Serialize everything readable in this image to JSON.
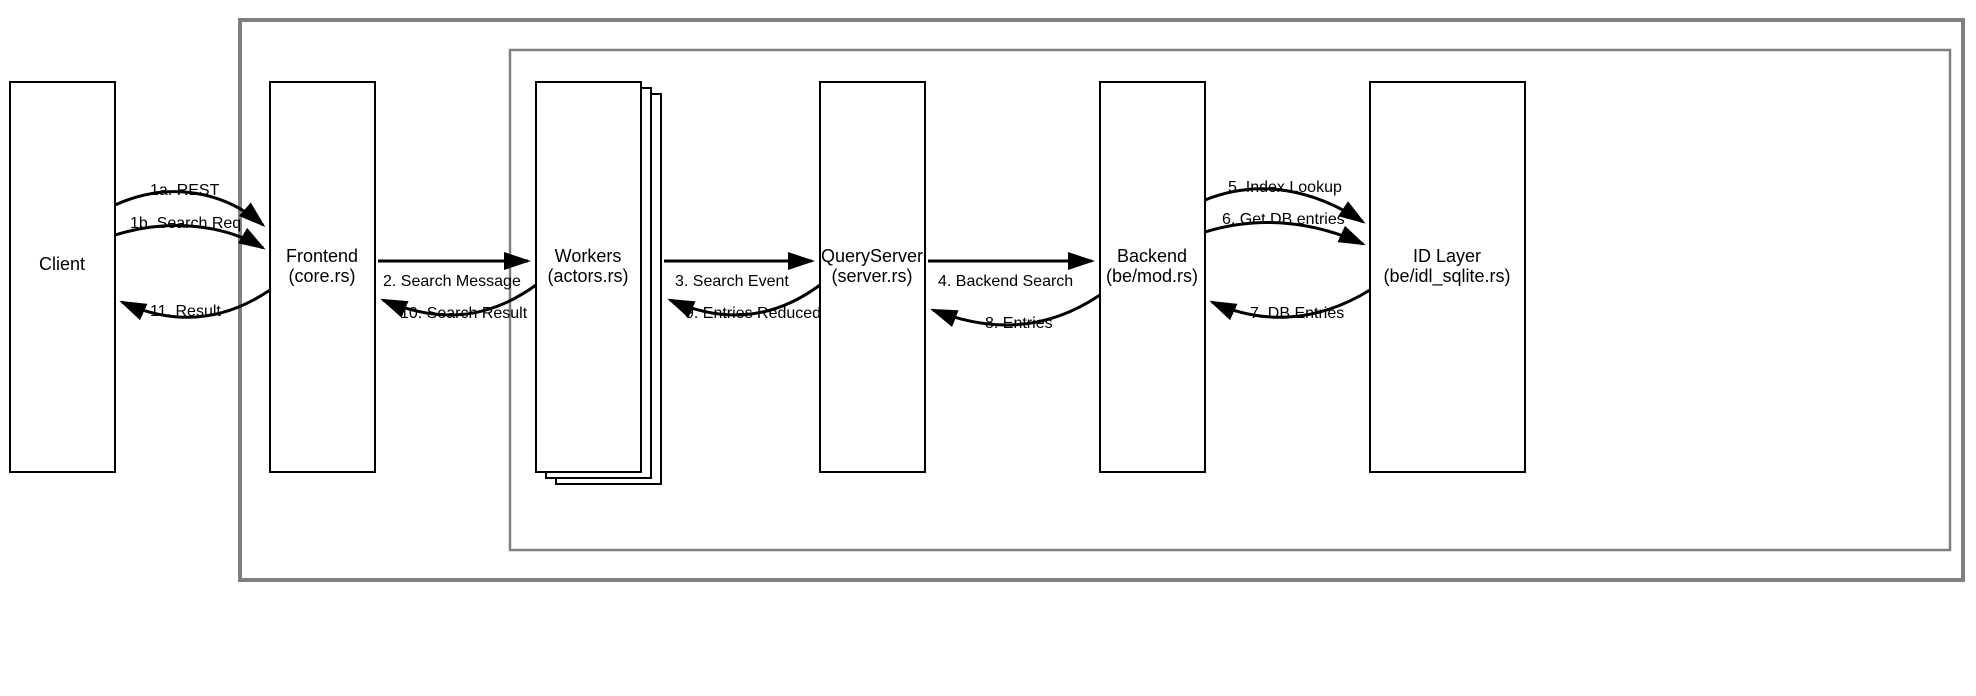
{
  "nodes": {
    "client": {
      "title": "Client"
    },
    "frontend": {
      "title": "Frontend",
      "subtitle": "(core.rs)"
    },
    "workers": {
      "title": "Workers",
      "subtitle": "(actors.rs)"
    },
    "queryserver": {
      "title": "QueryServer",
      "subtitle": "(server.rs)"
    },
    "backend": {
      "title": "Backend",
      "subtitle": "(be/mod.rs)"
    },
    "idlayer": {
      "title": "ID Layer",
      "subtitle": "(be/idl_sqlite.rs)"
    }
  },
  "edges": {
    "e1a": "1a. REST",
    "e1b": "1b. Search Req",
    "e2": "2. Search Message",
    "e3": "3. Search Event",
    "e4": "4. Backend Search",
    "e5": "5. Index Lookup",
    "e6": "6. Get DB entries",
    "e7": "7. DB Entries",
    "e8": "8. Entries",
    "e9": "9. Entries Reduced",
    "e10": "10. Search Result",
    "e11": "11. Result"
  }
}
